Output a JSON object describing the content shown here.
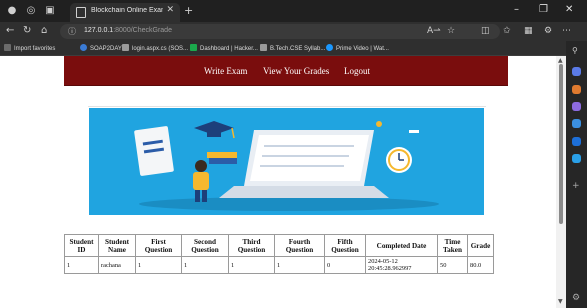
{
  "browser": {
    "tab_title": "Blockchain Online Exam Results",
    "url_host": "127.0.0.1",
    "url_path": ":8000/CheckGrade",
    "bookmarks": [
      {
        "label": "Import favorites",
        "color": "#6b6b6b"
      },
      {
        "label": "SOAP2DAY",
        "color": "#3a7bd5"
      },
      {
        "label": "login.aspx.cs (SOS...",
        "color": "#9a9a9a"
      },
      {
        "label": "Dashboard | Hacker...",
        "color": "#1ba94c"
      },
      {
        "label": "B.Tech.CSE Syllab...",
        "color": "#9a9a9a"
      },
      {
        "label": "Prime Video | Wat...",
        "color": "#1a98ff"
      }
    ]
  },
  "nav": {
    "write_exam": "Write Exam",
    "view_grades": "View Your Grades",
    "logout": "Logout"
  },
  "table": {
    "headers": [
      "Student ID",
      "Student Name",
      "First Question",
      "Second Question",
      "Third Question",
      "Fourth Question",
      "Fifth Question",
      "Completed Date",
      "Time Taken",
      "Grade"
    ],
    "rows": [
      [
        "1",
        "rachana",
        "1",
        "1",
        "1",
        "1",
        "0",
        "2024-05-12 20:45:28.962997",
        "50",
        "80.0"
      ]
    ]
  },
  "colors": {
    "nav_background": "#7a0d0d",
    "banner_background": "#20a4e0"
  }
}
